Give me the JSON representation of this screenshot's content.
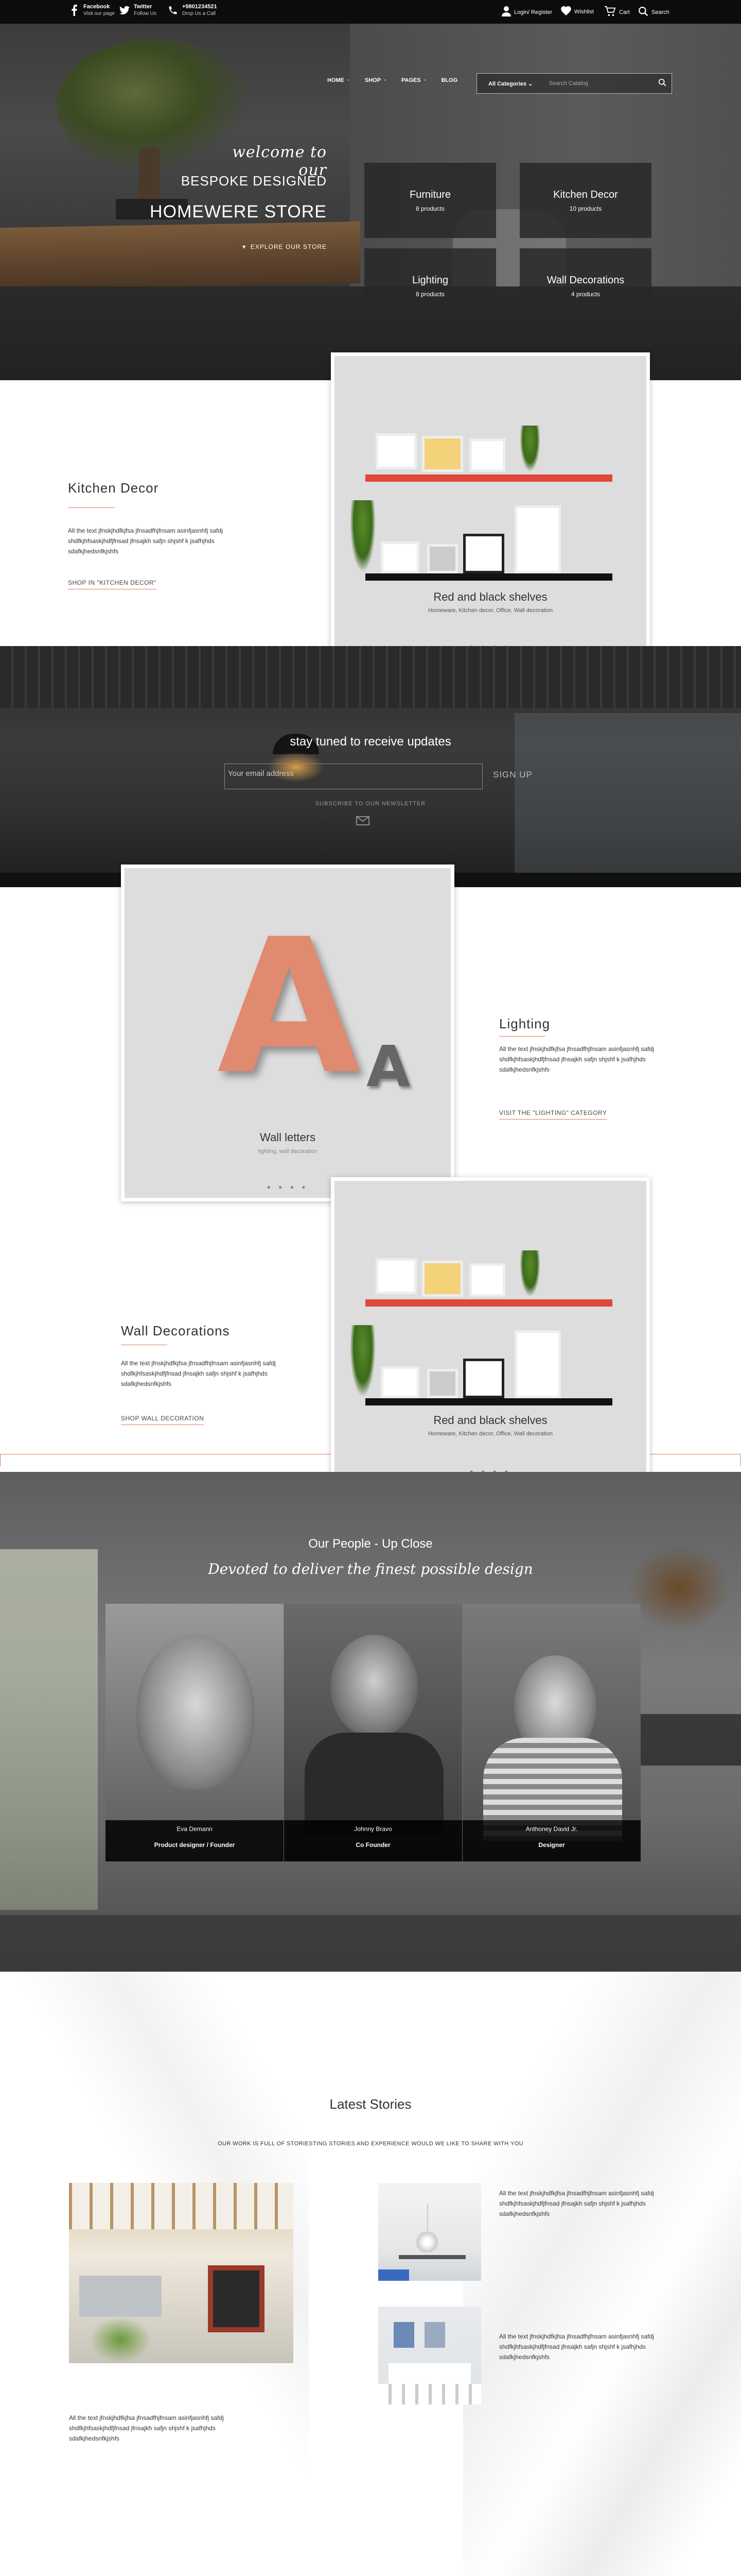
{
  "topbar": {
    "social": [
      {
        "icon": "facebook-icon",
        "title": "Facebook",
        "subtitle": "Visit our page"
      },
      {
        "icon": "twitter-icon",
        "title": "Twitter",
        "subtitle": "Follow Us"
      },
      {
        "icon": "phone-icon",
        "title": "+9801234521",
        "subtitle": "Drop Us a Call"
      }
    ],
    "right": [
      {
        "icon": "user-icon",
        "label": "Login/ Register"
      },
      {
        "icon": "heart-icon",
        "label": "Wishlist"
      },
      {
        "icon": "cart-icon",
        "label": "Cart"
      },
      {
        "icon": "search-icon",
        "label": "Search"
      }
    ]
  },
  "hero": {
    "welcome": "welcome to our",
    "line2": "BESPOKE DESIGNED",
    "line3": "HOMEWERE STORE",
    "explore": "EXPLORE OUR STORE",
    "nav": [
      "HOME",
      "SHOP",
      "PAGES",
      "BLOG"
    ],
    "search": {
      "category": "All Categories",
      "placeholder": "Search Catalog"
    },
    "tiles": [
      {
        "name": "Furniture",
        "count": "8 products"
      },
      {
        "name": "Kitchen Decor",
        "count": "10 products"
      },
      {
        "name": "Lighting",
        "count": "8 products"
      },
      {
        "name": "Wall Decorations",
        "count": "4 products"
      }
    ]
  },
  "kitchen": {
    "title": "Kitchen Decor",
    "text": "All the text jfnskjhdfkjfsa jfnsadfhjfnsam asinfjasnhfj safdj shdfkjhfsaskjhdfjfnsad jfnsajkh safjn shjshf k jsafhjhds sdafkjhedsnfkjshfs",
    "link": "SHOP IN \"KITCHEN DECOR\"",
    "card": {
      "caption": "Red and black shelves",
      "sub": "Homeware, Kitchen decor, Office, Wall decoration",
      "dots": "● ● ● ●"
    }
  },
  "newsletter": {
    "title": "stay tuned to receive updates",
    "placeholder": "Your email address",
    "button": "SIGN UP",
    "sub": "SUBSCRIBE TO OUR NEWSLETTER"
  },
  "lighting": {
    "title": "Lighting",
    "text": "All the text jfnskjhdfkjfsa jfnsadfhjfnsam asinfjasnhfj safdj shdfkjhfsaskjhdfjfnsad jfnsajkh safjn shjshf k jsafhjhds sdafkjhedsnfkjshfs",
    "link": "VISIT THE \"LIGHTING\" CATEGORY",
    "card": {
      "caption": "Wall letters",
      "sub": "lighting, wall decoration",
      "dots": "● ● ● ●",
      "letter_big": "A",
      "letter_small": "A"
    }
  },
  "wall": {
    "title": "Wall Decorations",
    "text": "All the text jfnskjhdfkjfsa jfnsadfhjfnsam asinfjasnhfj safdj shdfkjhfsaskjhdfjfnsad jfnsajkh safjn shjshf k jsafhjhds sdafkjhedsnfkjshfs",
    "link": "SHOP WALL DECORATION",
    "card": {
      "caption": "Red and black shelves",
      "sub": "Homeware, Kitchen decor, Office, Wall decoration",
      "dots": "● ● ● ●"
    }
  },
  "people": {
    "title": "Our People - Up Close",
    "tagline": "Devoted to deliver the finest possible design",
    "members": [
      {
        "name": "Eva Demann",
        "role": "Product designer / Founder"
      },
      {
        "name": "Johnny Bravo",
        "role": "Co Founder"
      },
      {
        "name": "Anthoney David Jr.",
        "role": "Designer"
      }
    ]
  },
  "stories": {
    "title": "Latest Stories",
    "subtitle": "OUR WORK IS FULL OF STORIESTING STORIES AND EXPERIENCE WOULD WE LIKE TO SHARE WITH YOU",
    "main_text": "All the text jfnskjhdfkjfsa jfnsadfhjfnsam asinfjasnhfj safdj shdfkjhfsaskjhdfjfnsad jfnsajkh safjn shjshf k jsafhjhds sdafkjhedsnfkjshfs",
    "item1_text": "All the text jfnskjhdfkjfsa jfnsadfhjfnsam asinfjasnhfj safdj shdfkjhfsaskjhdfjfnsad jfnsajkh safjn shjshf k jsafhjhds sdafkjhedsnfkjshfs",
    "item2_text": "All the text jfnskjhdfkjfsa jfnsadfhjfnsam asinfjasnhfj safdj shdfkjhfsaskjhdfjfnsad jfnsajkh safjn shjshf k jsafhjhds sdafkjhedsnfkjshfs"
  },
  "colors": {
    "accent": "#e07a5f",
    "dark": "#0c0c0c"
  }
}
